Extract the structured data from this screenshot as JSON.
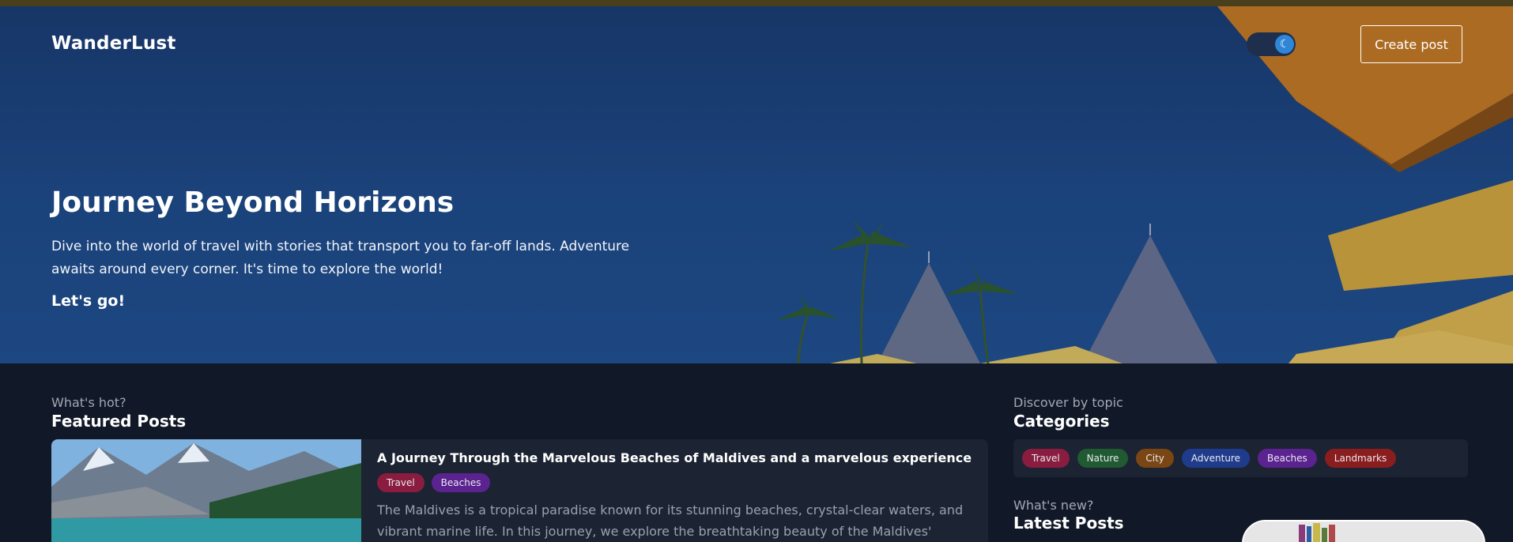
{
  "brand": "WanderLust",
  "header": {
    "create_post_label": "Create post",
    "theme_toggle_icon": "moon-icon"
  },
  "hero": {
    "title": "Journey Beyond Horizons",
    "description": "Dive into the world of travel with stories that transport you to far-off lands. Adventure awaits around every corner. It's time to explore the world!",
    "cta": "Let's go!"
  },
  "featured": {
    "eyebrow": "What's hot?",
    "title": "Featured Posts",
    "post": {
      "title": "A Journey Through the Marvelous Beaches of Maldives and a marvelous experience",
      "tags": [
        {
          "label": "Travel",
          "color": "#8a1d3f"
        },
        {
          "label": "Beaches",
          "color": "#5b2390"
        }
      ],
      "excerpt": "The Maldives is a tropical paradise known for its stunning beaches, crystal-clear waters, and vibrant marine life. In this journey, we explore the breathtaking beauty of the Maldives'"
    }
  },
  "categories": {
    "eyebrow": "Discover by topic",
    "title": "Categories",
    "items": [
      {
        "label": "Travel",
        "color": "#8a1d3f"
      },
      {
        "label": "Nature",
        "color": "#1f5a32"
      },
      {
        "label": "City",
        "color": "#7a4614"
      },
      {
        "label": "Adventure",
        "color": "#1f3c8c"
      },
      {
        "label": "Beaches",
        "color": "#5b2390"
      },
      {
        "label": "Landmarks",
        "color": "#8a1d1d"
      }
    ]
  },
  "latest": {
    "eyebrow": "What's new?",
    "title": "Latest Posts"
  },
  "colors": {
    "page_bg": "#111827",
    "card_bg": "#1c2333",
    "hero_bg": "#1f4a86",
    "accent": "#2f86d6"
  }
}
